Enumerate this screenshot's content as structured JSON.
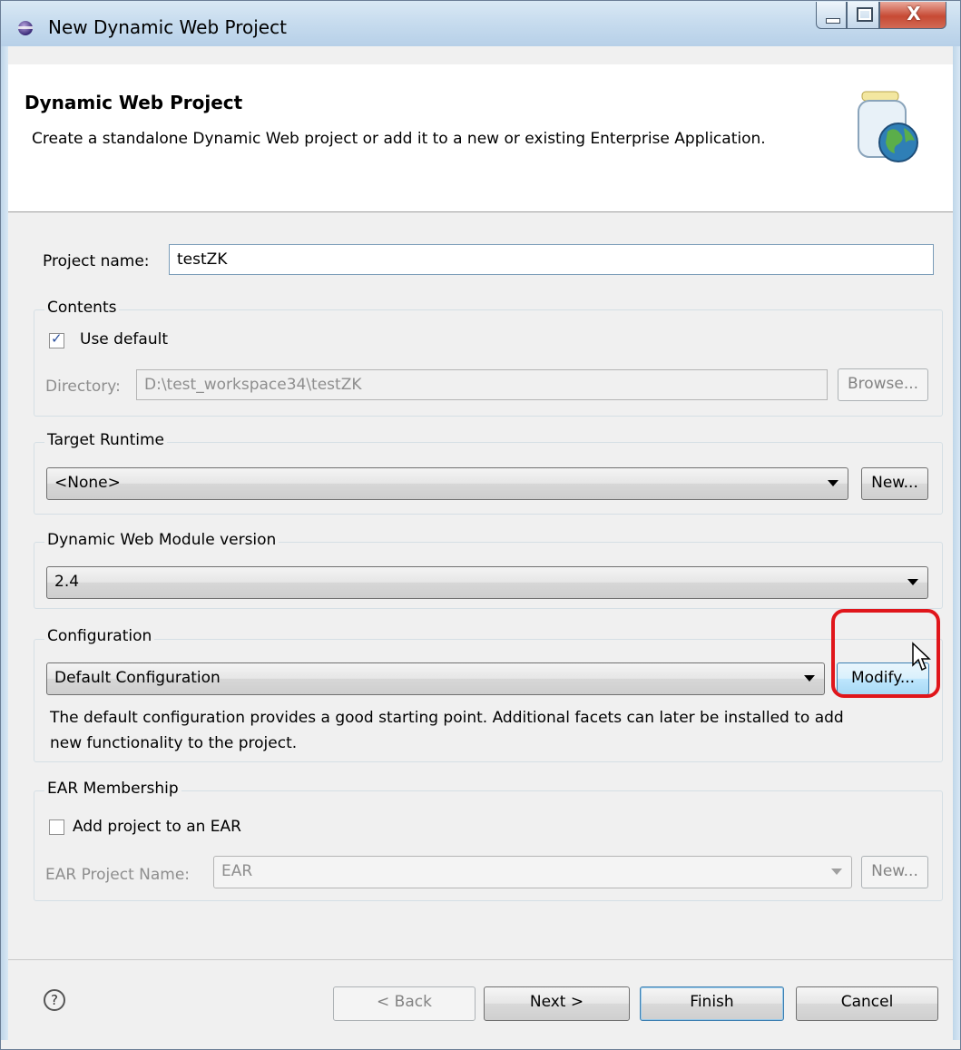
{
  "window": {
    "title": "New Dynamic Web Project",
    "controls": {
      "minimize": "minimize-icon",
      "maximize": "maximize-icon",
      "close": "X"
    }
  },
  "header": {
    "title": "Dynamic Web Project",
    "description": "Create a standalone Dynamic Web project or add it to a new or existing Enterprise Application.",
    "image_icon": "web-project-jar-globe-icon"
  },
  "project_name": {
    "label": "Project name:",
    "value": "testZK"
  },
  "contents": {
    "title": "Contents",
    "use_default_label": "Use default",
    "use_default_checked": true,
    "directory_label": "Directory:",
    "directory_value": "D:\\test_workspace34\\testZK",
    "browse_label": "Browse..."
  },
  "target_runtime": {
    "title": "Target Runtime",
    "selected": "<None>",
    "new_label": "New..."
  },
  "module_version": {
    "title": "Dynamic Web Module version",
    "selected": "2.4"
  },
  "configuration": {
    "title": "Configuration",
    "selected": "Default Configuration",
    "modify_label": "Modify...",
    "note_line1": "The default configuration provides a good starting point. Additional facets can later be installed to add",
    "note_line2": "new functionality to the project.",
    "highlight_color": "#e0161b"
  },
  "ear": {
    "title": "EAR Membership",
    "add_label": "Add project to an EAR",
    "add_checked": false,
    "project_name_label": "EAR Project Name:",
    "project_name_value": "EAR",
    "new_label": "New..."
  },
  "footer": {
    "help_icon": "?",
    "back_label": "< Back",
    "next_label": "Next >",
    "finish_label": "Finish",
    "cancel_label": "Cancel"
  }
}
